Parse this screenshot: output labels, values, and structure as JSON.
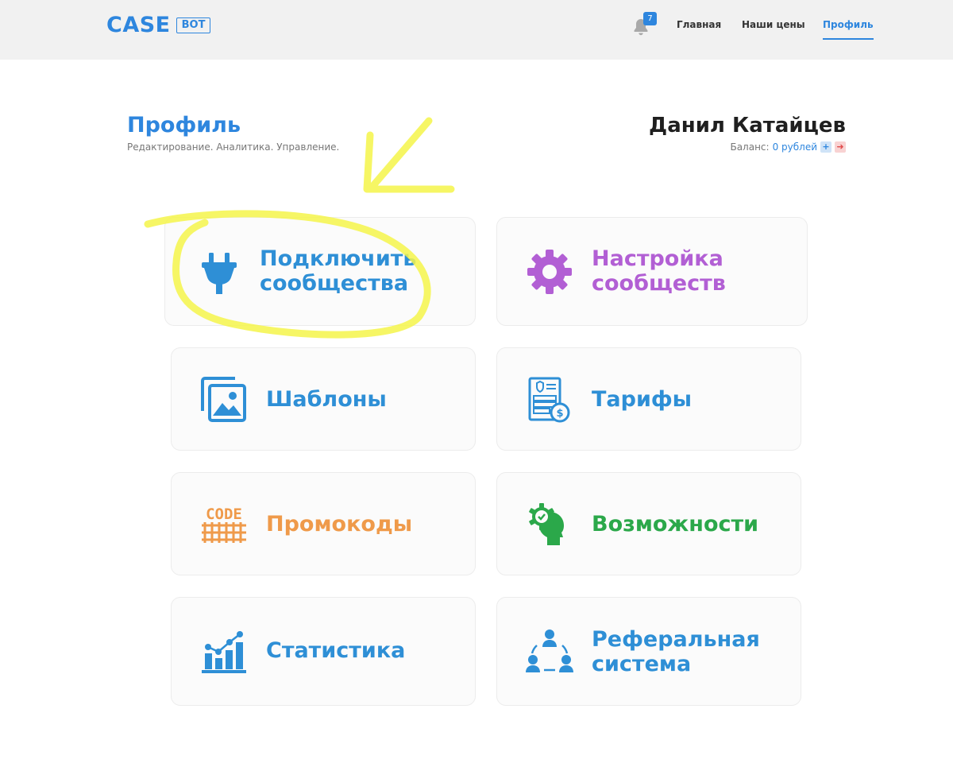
{
  "header": {
    "logo": {
      "main": "CASE",
      "tag": "BOT"
    },
    "notifications": {
      "count": "7"
    },
    "nav": [
      {
        "label": "Главная"
      },
      {
        "label": "Наши цены"
      },
      {
        "label": "Профиль",
        "active": true
      }
    ]
  },
  "profile": {
    "title": "Профиль",
    "subtitle": "Редактирование. Аналитика. Управление.",
    "user_name": "Данил Катайцев",
    "balance_label": "Баланс:",
    "balance_value": "0 рублей",
    "add_symbol": "+",
    "logout_symbol": "➜"
  },
  "cards": [
    {
      "label": "Подключить\nсообщества",
      "icon": "plug-icon",
      "color": "#2e8fd6"
    },
    {
      "label": "Настройка\nсообществ",
      "icon": "gear-icon",
      "color": "#b25fd4"
    },
    {
      "label": "Шаблоны",
      "icon": "images-icon",
      "color": "#2e8fd6"
    },
    {
      "label": "Тарифы",
      "icon": "invoice-icon",
      "color": "#2e8fd6"
    },
    {
      "label": "Промокоды",
      "icon": "code-icon",
      "color": "#ef9a4a"
    },
    {
      "label": "Возможности",
      "icon": "head-gear-icon",
      "color": "#2ba84a"
    },
    {
      "label": "Статистика",
      "icon": "chart-icon",
      "color": "#2e8fd6"
    },
    {
      "label": "Реферальная\nсистема",
      "icon": "referral-icon",
      "color": "#2e8fd6"
    }
  ],
  "colors": {
    "accent": "#2e86de",
    "header_bg": "#f1f1f1",
    "annotation": "#f5f54a"
  }
}
